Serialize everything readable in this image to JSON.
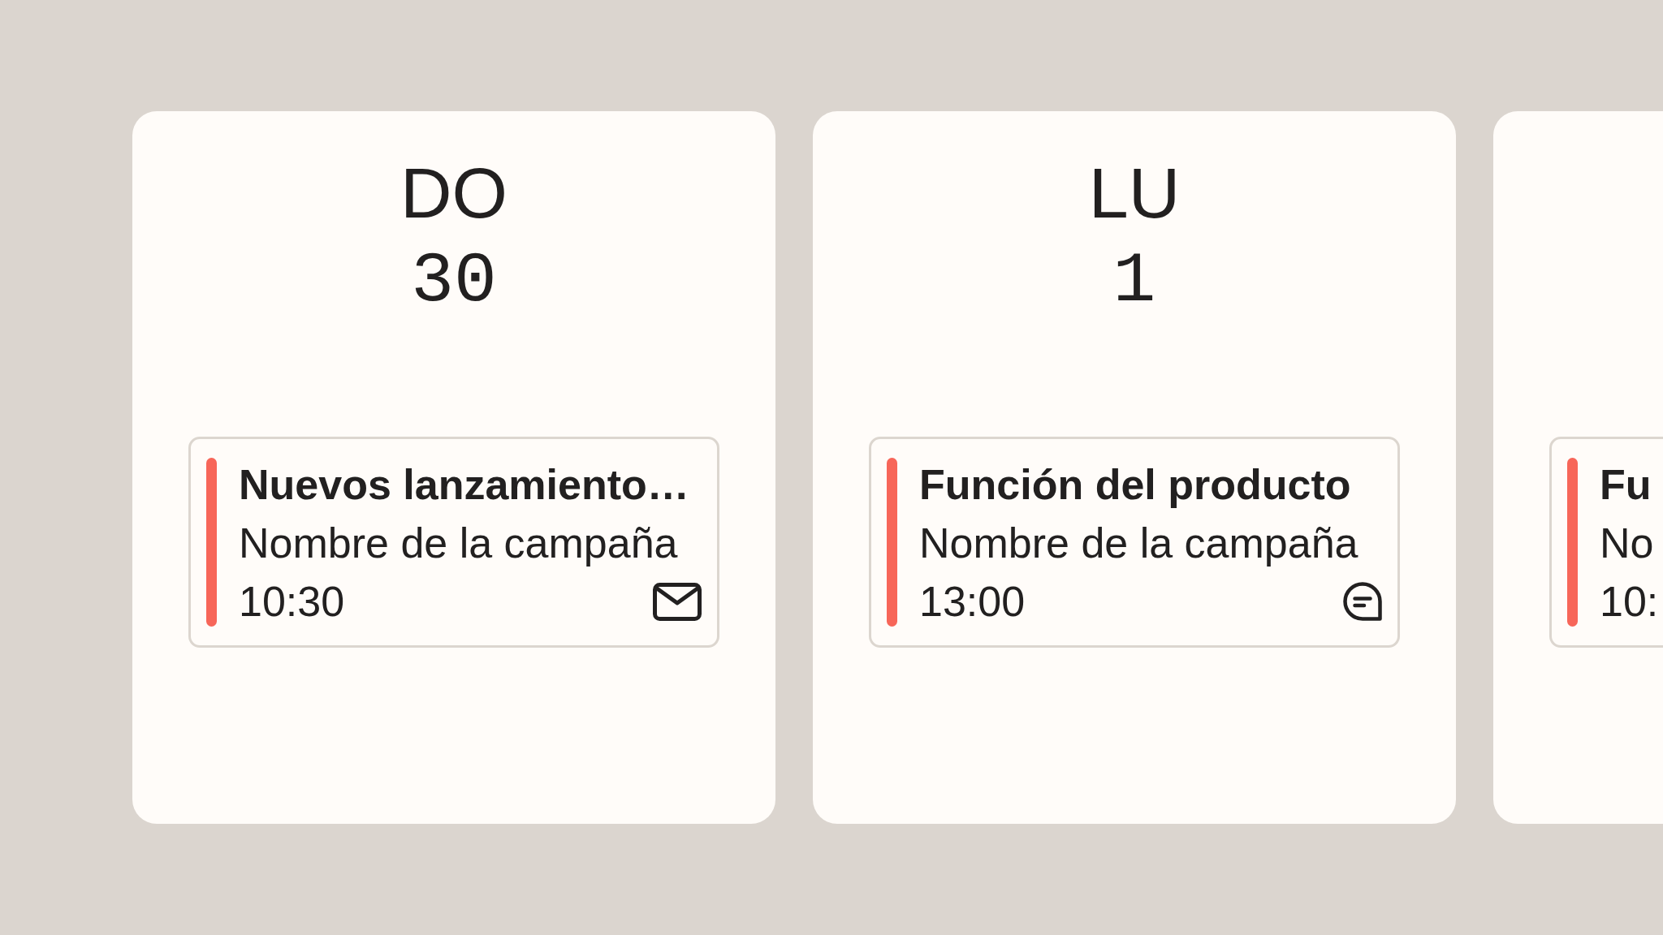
{
  "days": [
    {
      "weekday": "DO",
      "date": "30",
      "events": [
        {
          "title": "Nuevos lanzamiento…",
          "campaign": "Nombre de la campaña",
          "time": "10:30",
          "kind": "email",
          "color": "#f76659"
        }
      ]
    },
    {
      "weekday": "LU",
      "date": "1",
      "events": [
        {
          "title": "Función del producto",
          "campaign": "Nombre de la campaña",
          "time": "13:00",
          "kind": "chat",
          "color": "#f76659"
        }
      ]
    },
    {
      "events": [
        {
          "title": "Fu",
          "campaign": "No",
          "time": "10:",
          "color": "#f76659"
        }
      ]
    }
  ]
}
